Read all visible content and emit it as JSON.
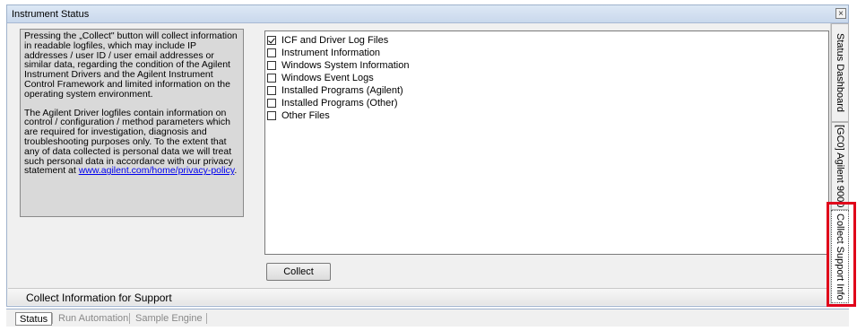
{
  "window": {
    "title": "Instrument Status",
    "close_symbol": "×"
  },
  "info": {
    "paragraph1": "Pressing the „Collect\" button will collect information in readable logfiles, which may include IP addresses / user ID / user email addresses or similar data, regarding the condition of the Agilent Instrument Drivers and the Agilent Instrument Control Framework and limited information on the operating system environment.",
    "paragraph2": "The Agilent Driver logfiles contain information on control / configuration / method parameters which are required for investigation, diagnosis and troubleshooting purposes only. To the extent that any of data collected is personal data we will treat such personal data in accordance with our privacy statement at",
    "link_text": "www.agilent.com/home/privacy-policy",
    "link_suffix": "."
  },
  "options": [
    {
      "label": "ICF and Driver Log Files",
      "checked": true
    },
    {
      "label": "Instrument Information",
      "checked": false
    },
    {
      "label": "Windows System Information",
      "checked": false
    },
    {
      "label": "Windows Event Logs",
      "checked": false
    },
    {
      "label": "Installed Programs (Agilent)",
      "checked": false
    },
    {
      "label": "Installed Programs (Other)",
      "checked": false
    },
    {
      "label": "Other Files",
      "checked": false
    }
  ],
  "collect_button": "Collect",
  "section_header": "Collect Information for Support",
  "side_tabs": [
    {
      "label": "Status Dashboard",
      "active": false
    },
    {
      "label": "[GC0] Agilent 9000",
      "active": false
    },
    {
      "label": "Collect Support Info",
      "active": true
    }
  ],
  "bottom_tabs": [
    {
      "label": "Status",
      "active": true
    },
    {
      "label": "Run Automation",
      "active": false
    },
    {
      "label": "Sample Engine",
      "active": false
    }
  ],
  "colors": {
    "highlight": "#e0001a",
    "link": "#0000ee"
  }
}
